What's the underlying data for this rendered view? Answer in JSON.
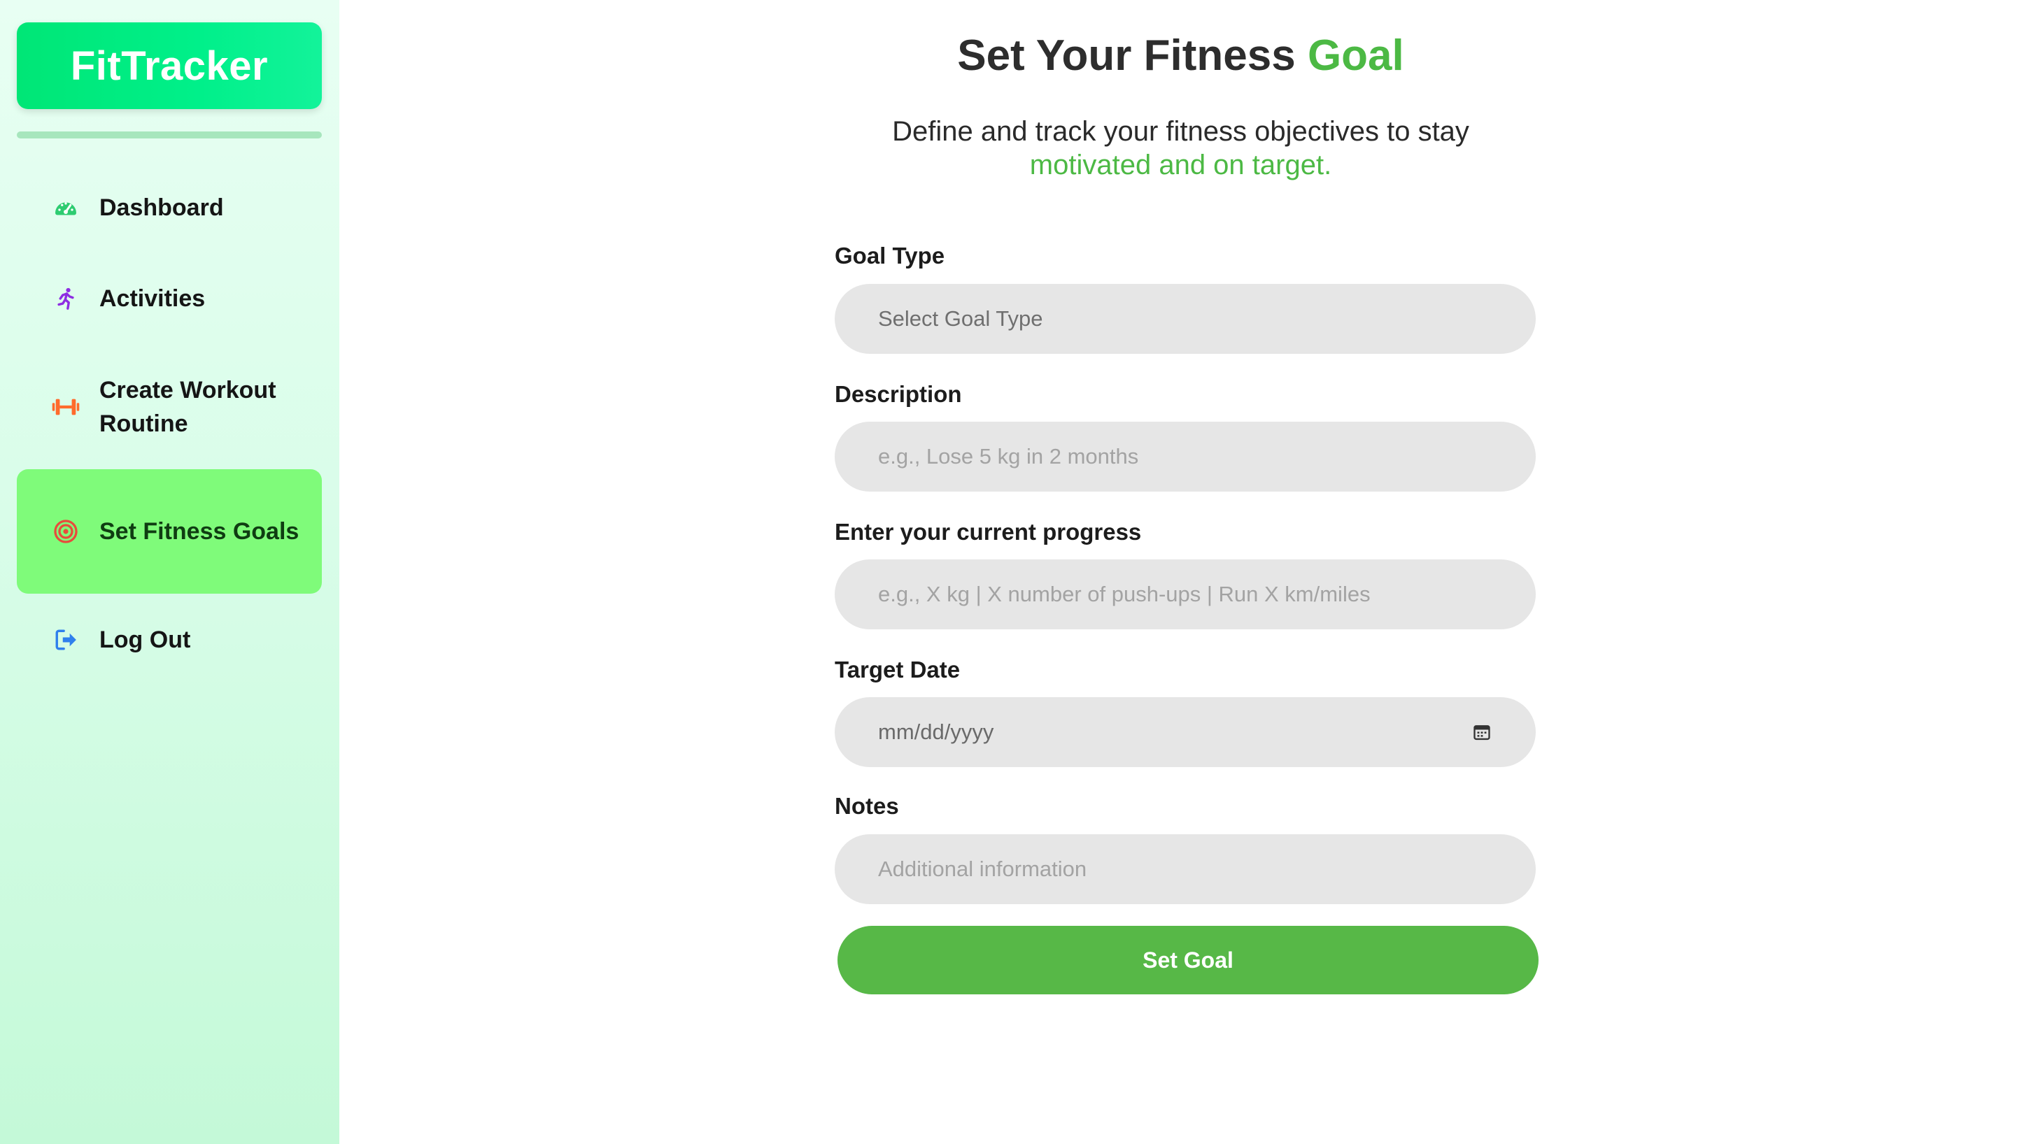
{
  "app": {
    "brand": "FitTracker"
  },
  "sidebar": {
    "items": [
      {
        "label": "Dashboard",
        "icon": "gauge-icon",
        "color": "#2ecc71"
      },
      {
        "label": "Activities",
        "icon": "running-icon",
        "color": "#8e2de2"
      },
      {
        "label": "Create Workout Routine",
        "icon": "dumbbell-icon",
        "color": "#ff6b2c"
      },
      {
        "label": "Set Fitness Goals",
        "icon": "target-icon",
        "color": "#e74c3c",
        "active": true
      },
      {
        "label": "Log Out",
        "icon": "logout-icon",
        "color": "#2f80ed"
      }
    ]
  },
  "page": {
    "title_main": "Set Your Fitness ",
    "title_accent": "Goal",
    "subtitle_line1": "Define and track your fitness objectives to stay",
    "subtitle_line2": "motivated and on target."
  },
  "form": {
    "goal_type": {
      "label": "Goal Type",
      "value": "Select Goal Type"
    },
    "description": {
      "label": "Description",
      "placeholder": "e.g., Lose 5 kg in 2 months"
    },
    "progress": {
      "label": "Enter your current progress",
      "placeholder": "e.g., X kg | X number of push-ups | Run X km/miles"
    },
    "target_date": {
      "label": "Target Date",
      "placeholder": "mm/dd/yyyy",
      "icon": "calendar-icon"
    },
    "notes": {
      "label": "Notes",
      "placeholder": "Additional information"
    },
    "submit_label": "Set Goal"
  },
  "colors": {
    "accent": "#4cb944",
    "brand_gradient_start": "#00e676",
    "active_nav": "#7ffb7a",
    "button": "#57b847",
    "field_bg": "#e6e6e6"
  }
}
